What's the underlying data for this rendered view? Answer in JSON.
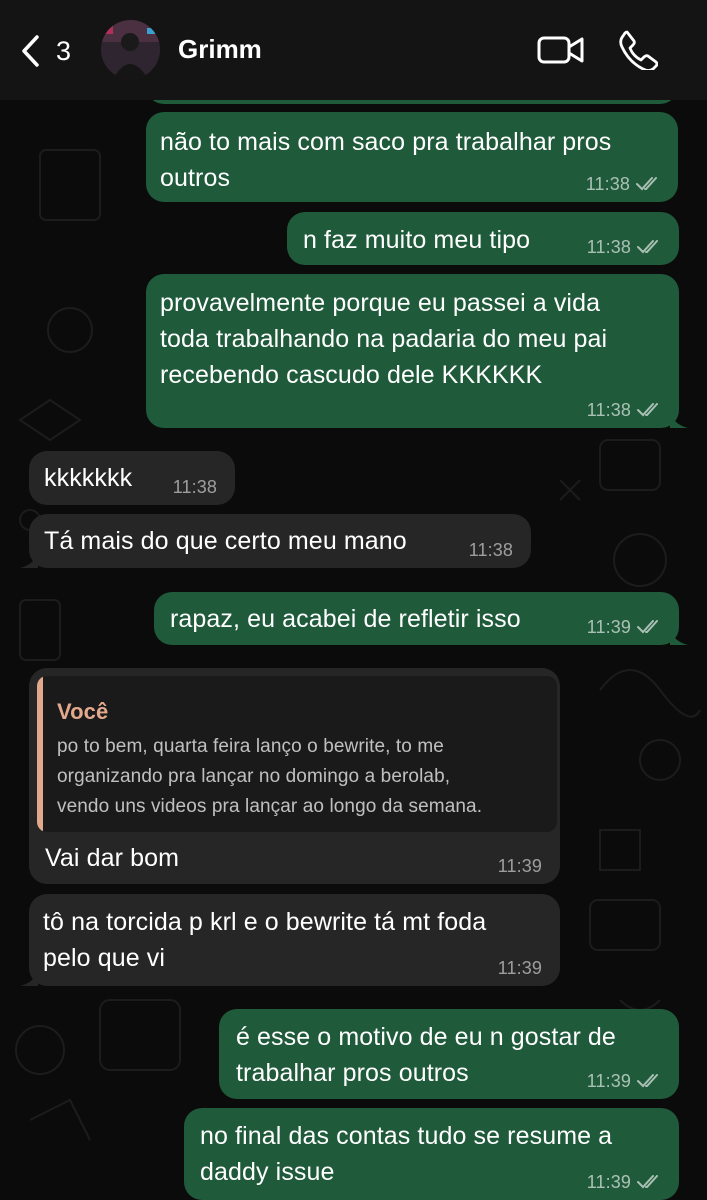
{
  "header": {
    "back_count": "3",
    "contact_name": "Grimm"
  },
  "colors": {
    "outgoing_bubble": "#1f5a3a",
    "incoming_bubble": "#262626",
    "quote_accent": "#e3a98d",
    "background": "#0b0b0b"
  },
  "icons": [
    "chevron-left-icon",
    "video-camera-icon",
    "phone-icon",
    "double-check-icon"
  ],
  "messages": [
    {
      "direction": "outgoing",
      "lines": [
        "não to mais com saco pra trabalhar pros",
        "outros"
      ],
      "time": "11:38",
      "status": "read"
    },
    {
      "direction": "outgoing",
      "lines": [
        "n faz muito meu tipo"
      ],
      "time": "11:38",
      "status": "read"
    },
    {
      "direction": "outgoing",
      "lines": [
        "provavelmente porque eu passei a vida",
        "toda trabalhando na padaria do meu pai",
        "recebendo cascudo dele KKKKKK"
      ],
      "time": "11:38",
      "status": "read"
    },
    {
      "direction": "incoming",
      "lines": [
        "kkkkkkk"
      ],
      "time": "11:38"
    },
    {
      "direction": "incoming",
      "lines": [
        "Tá mais do que certo meu mano"
      ],
      "time": "11:38"
    },
    {
      "direction": "outgoing",
      "lines": [
        "rapaz, eu acabei de refletir isso"
      ],
      "time": "11:39",
      "status": "read"
    },
    {
      "direction": "incoming",
      "quote": {
        "author": "Você",
        "lines": [
          "po to bem, quarta feira lanço o bewrite, to me",
          "organizando pra lançar no domingo a berolab,",
          "vendo uns videos pra lançar ao longo da semana."
        ]
      },
      "lines": [
        "Vai dar bom"
      ],
      "time": "11:39"
    },
    {
      "direction": "incoming",
      "lines": [
        "tô na torcida p krl e o bewrite tá mt foda",
        "pelo que vi"
      ],
      "time": "11:39"
    },
    {
      "direction": "outgoing",
      "lines": [
        "é esse o motivo de eu n gostar de",
        "trabalhar pros outros"
      ],
      "time": "11:39",
      "status": "read"
    },
    {
      "direction": "outgoing",
      "lines": [
        "no final das contas tudo se resume a",
        "daddy issue"
      ],
      "time": "11:39",
      "status": "read"
    }
  ]
}
